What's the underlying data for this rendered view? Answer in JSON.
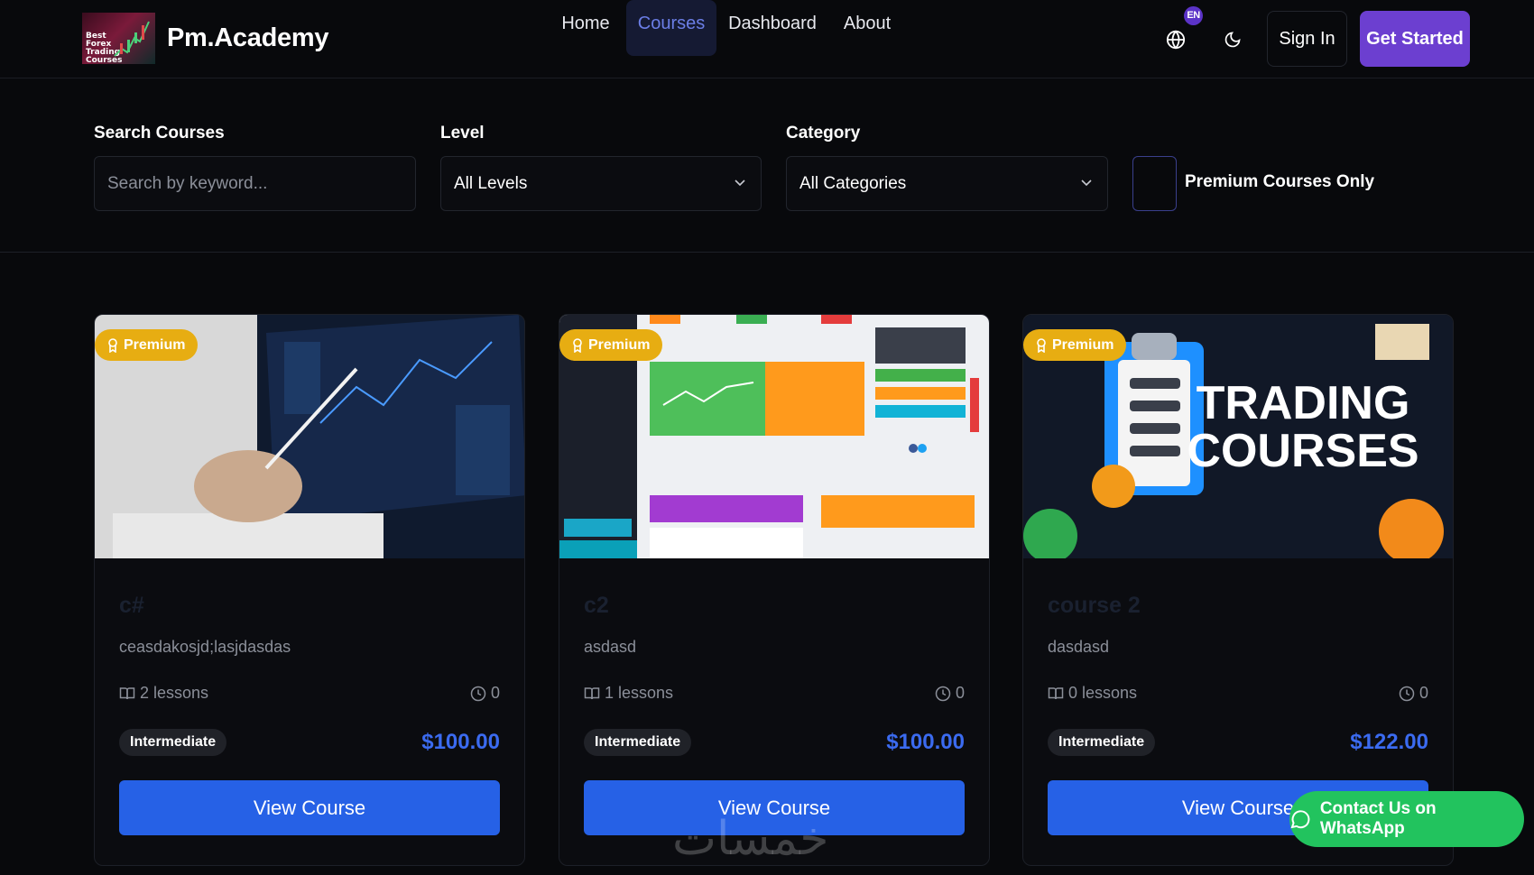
{
  "header": {
    "brand": "Pm.Academy",
    "logo_text": "Best Forex Trading Courses",
    "nav": [
      {
        "label": "Home",
        "active": false
      },
      {
        "label": "Courses",
        "active": true
      },
      {
        "label": "Dashboard",
        "active": false
      },
      {
        "label": "About",
        "active": false
      }
    ],
    "lang_badge": "EN",
    "signin_label": "Sign In",
    "getstarted_label": "Get Started"
  },
  "filters": {
    "search_label": "Search Courses",
    "search_placeholder": "Search by keyword...",
    "level_label": "Level",
    "level_value": "All Levels",
    "category_label": "Category",
    "category_value": "All Categories",
    "premium_only_label": "Premium Courses Only"
  },
  "courses": [
    {
      "badge": "Premium",
      "title": "c#",
      "description": "ceasdakosjd;lasjdasdas",
      "lessons": "2 lessons",
      "duration": "0",
      "level": "Intermediate",
      "price": "$100.00",
      "button": "View Course"
    },
    {
      "badge": "Premium",
      "title": "c2",
      "description": "asdasd",
      "lessons": "1 lessons",
      "duration": "0",
      "level": "Intermediate",
      "price": "$100.00",
      "button": "View Course"
    },
    {
      "badge": "Premium",
      "title": "course 2",
      "description": "dasdasd",
      "lessons": "0 lessons",
      "duration": "0",
      "level": "Intermediate",
      "price": "$122.00",
      "button": "View Course",
      "thumb_text": [
        "TRADING",
        "COURSES"
      ]
    }
  ],
  "whatsapp_label": "Contact Us on WhatsApp",
  "watermark": "خمسات",
  "colors": {
    "accent": "#6c3fd0",
    "primary_button": "#2661e6",
    "premium_badge": "#e7ad12",
    "whatsapp": "#22c35e",
    "price": "#3b6bf0"
  }
}
